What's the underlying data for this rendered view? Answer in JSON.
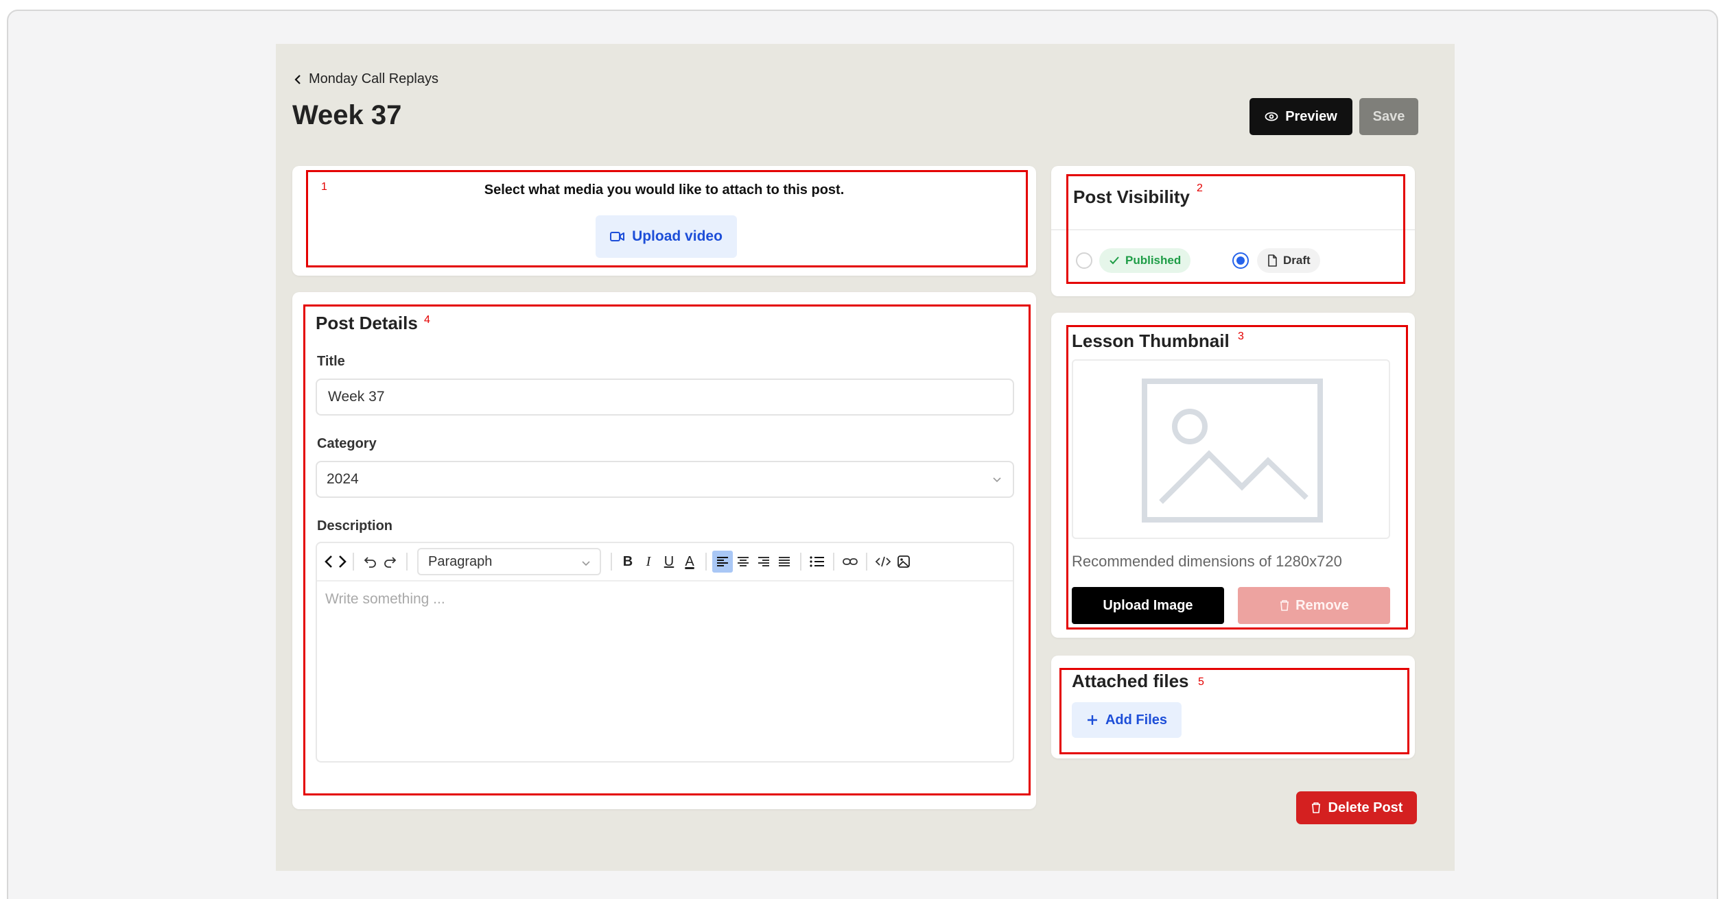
{
  "header": {
    "back_label": "Monday Call Replays",
    "page_title": "Week 37",
    "preview_label": "Preview",
    "save_label": "Save"
  },
  "media": {
    "prompt": "Select what media you would like to attach to this post.",
    "upload_video_label": "Upload video",
    "annotation": "1"
  },
  "post_details": {
    "heading": "Post Details",
    "annotation": "4",
    "title_label": "Title",
    "title_value": "Week 37",
    "category_label": "Category",
    "category_value": "2024",
    "description_label": "Description",
    "editor_block_format": "Paragraph",
    "editor_placeholder": "Write something ...",
    "toolbar": {
      "bold": "B",
      "italic": "I",
      "underline": "U",
      "font_color": "A"
    }
  },
  "visibility": {
    "heading": "Post Visibility",
    "annotation": "2",
    "published_label": "Published",
    "draft_label": "Draft",
    "selected": "Draft"
  },
  "thumbnail": {
    "heading": "Lesson Thumbnail",
    "annotation": "3",
    "hint": "Recommended dimensions of 1280x720",
    "upload_label": "Upload Image",
    "remove_label": "Remove"
  },
  "attached_files": {
    "heading": "Attached files",
    "annotation": "5",
    "add_label": "Add Files"
  },
  "delete_label": "Delete Post",
  "colors": {
    "page_bg": "#e8e7e0",
    "accent_blue": "#1d4ed8",
    "annotation_red": "#e40000",
    "delete_red": "#d42020"
  },
  "icons": [
    "chevron-left-icon",
    "eye-icon",
    "video-icon",
    "check-icon",
    "file-icon",
    "image-placeholder-icon",
    "trash-icon",
    "plus-icon",
    "chevron-down-icon",
    "code-view-icon",
    "undo-icon",
    "redo-icon",
    "align-left-icon",
    "align-center-icon",
    "align-right-icon",
    "align-justify-icon",
    "bullet-list-icon",
    "link-icon",
    "code-icon",
    "insert-image-icon"
  ]
}
